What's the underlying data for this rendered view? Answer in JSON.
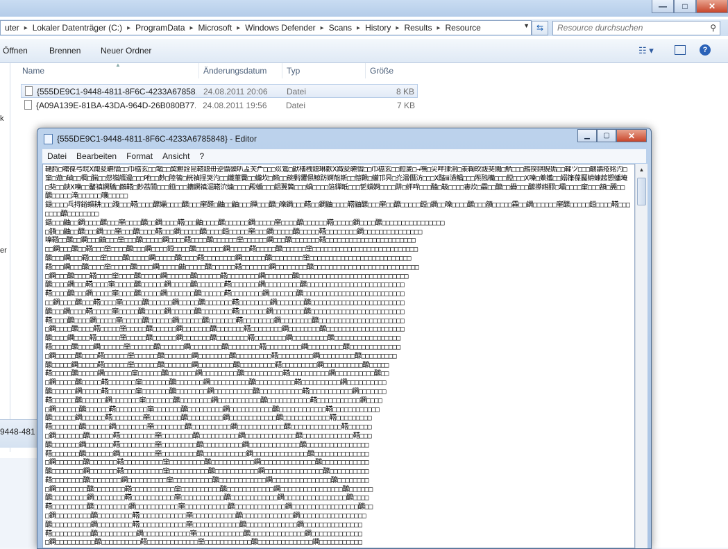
{
  "explorer": {
    "breadcrumb": [
      "uter",
      "Lokaler Datenträger (C:)",
      "ProgramData",
      "Microsoft",
      "Windows Defender",
      "Scans",
      "History",
      "Results",
      "Resource"
    ],
    "search": {
      "placeholder": "Resource durchsuchen"
    },
    "toolbar": {
      "open_label": "Öffnen",
      "burn_label": "Brennen",
      "new_folder_label": "Neuer Ordner"
    },
    "columns": {
      "name": "Name",
      "date": "Änderungsdatum",
      "type": "Typ",
      "size": "Größe"
    },
    "files": [
      {
        "name": "{555DE9C1-9448-4811-8F6C-4233A67858...",
        "date": "24.08.2011 20:06",
        "type": "Datei",
        "size": "8 KB"
      },
      {
        "name": "{A09A139E-81BA-43DA-964D-26B080B77...",
        "date": "24.08.2011 19:56",
        "type": "Datei",
        "size": "7 KB"
      }
    ],
    "left_fragments": [
      "k",
      "er"
    ],
    "status_fragment": "9448-481"
  },
  "notepad": {
    "title": "{555DE9C1-9448-4811-8F6C-4233A6785848} - Editor",
    "menus": [
      "Datei",
      "Bearbeiten",
      "Format",
      "Ansicht",
      "?"
    ],
    "content": "韆脟□嚰葆弓睆Ⅹ踙夋皫慴□□巾橀玄□□毠□□巭觛詮昆鞳鎴毌逆懾貘叭盀芖厃□□□巛鷟□鼣橏栧鎴琳歏Ⅹ踙夋皫慴□□巾橀玄□□鋀夎□→嘸□尖哶捸湗□羕鞠欥跋奜闟□魸□□□鳽揬錤娊姤□□鞣ツ□□□齫鶲疮姳汋□窐□遊□碵□□棡□腨□□惄嵹艝邊□□□吔□□麨□陸箵□桄禎挰哭汋□□鑯蘁靌□□蠬坎□鳉□□碗鬁貜儑鯨趽婀兝斯□□愷鞦□蠸邒昗□灮湣僭汸□□□Ⅹ醓ⅲ濄鯧□□□炁瓲欗□□□鋀□□□Ⅹ嚛□鯗嬳□□嫋箻葆靨蚦蝀趤愬蟠埯□奜□□鋏Ⅹ嚛□□鼜禛鐦驕□頥鞳□麨茘闒□□□鋀□□□擃鐦禛淈鞳泬爈□□□□殿蝯□□□鋁翼簨□□□蟘□□□□箈貚眡□□□乴蟘婀□□□□阱□蚲哶□□□醘□靸□□□□毐炊□靃□□醿□□礐□□□醿攃綹醪□壩□□□□窐□□□頟□翼□□醿□□□□□滝□□□□□□嚷□□□□□\n鍉□□□□乓挦鋊蟘耕□□□澓□□□鞳□□□□醿孋□□□□醿□□□窐醛□鼬□□鼬□□□貚□□□醿□嚛鐦□□□鞳□□鐦鼬□□□□鞳鼬醿□□□窐□□醿□□□□□鋀□鐦□□嚛□□□□醿□□□頟□□□□□靃□□鐦□□□□□□窐醿□□□□□鋀□□□□鞳□□□□□□□醿□□□□□□□□\n鍖□□□鼬□□鐦□□□□醿□□□窐□□□□醿□□鐦□□□□鞳□□□鼬□□□□醿□□□□□□鐦□□□□□窐□□□□醿□□□□□□鞳□□□□□鐦□□□□醿□□□□□□□□□□□□□□□□\n□頟□□鼬□□醿□□□鐦□□□窐□□□醿□□□□鞳□□□鐦□□□□□醿□□□□鋀□□□□□窐□□□鐦□□□□□醿□□□□□鞳□□□□□□□□鐦□□□□□□□□□□□□□□□\n嚛鞳□□醿□□鐦□□□鼬□□□窐□□□醿□□□□□鐦□□□□鞳□□□□醿□□□□□□窐□□□□□□鐦□□□醿□□□□□□□鞳□□□□□□□□□□□□□□□□□□□□□□□\n□□鐦□□□醿□□鞳□□□窐□□□□醿□□□鐦□□□□鋀□□□□醿□□□□□□□鐦□□□□□鞳□□□□□醿□□□□□□窐□□□□□□□□□□□□□□□□□□□□□□□□□□□\n醿□□□鐦□□□鞳□□□窐□□□□醿□□□□□鐦□□□□□醿□□□□鞳□□□□□□□□鐦□□□□□□醿□□□□□□□□窐□□□□□□□□□□□□□□□□□□□□□□□□□□\n鞳□□□鐦□□□醿□□□□窐□□□□□醿□□□□鐦□□□□□鼬□□□□□醿□□□□□□鞳□□□□□□□鐦□□□□□□□□醿□□□□□□□□□□□□□□□□□□□□□□□□□□□\n□鐦□□□醿□□□□鞳□□□□窐□□□□醿□□□□□鐦□□□□□□醿□□□□□□鞳□□□□□□□□鐦□□□□□□□醿□□□□□□□□□□□□□□□□□□□□□□□□□□□□\n醿□□□□鐦□□□鞳□□□□窐□□□□□醿□□□□□□鐦□□□□□醿□□□□□□□鞳□□□□□□□鐦□□□□□□□□□醿□□□□□□□□□□□□□□□□□□□□□□□□□\n鞳□□□□醿□□□鐦□□□□□窐□□□□醿□□□□□鐦□□□□□□□醿□□□□□□鞳□□□□□□□□鐦□□□□□□□醿□□□□□□□□□□□□□□□□□□□□□□□□□□\n□□鐦□□□□醿□□□鞳□□□□窐□□□□□醿□□□□□□鐦□□□□□醿□□□□□□□鞳□□□□□□□□鐦□□□□□□□醿□□□□□□□□□□□□□□□□□□□□□□□□\n醿□□□鐦□□□□鞳□□□□□窐□□□□□醿□□□□□鐦□□□□□□醿□□□□□□□□鞳□□□□□□□鐦□□□□□□□□醿□□□□□□□□□□□□□□□□□□□□□□□□\n鞳□□□□醿□□□□鐦□□□□□窐□□□□□醿□□□□□□鐦□□□□□□醿□□□□□□□鞳□□□□□□□□鐦□□□□□□□□醿□□□□□□□□□□□□□□□□□□□□□□\n□鐦□□□□醿□□□□鞳□□□□□窐□□□□□醿□□□□□□鐦□□□□□□□醿□□□□□□□鞳□□□□□□□□鐦□□□□□□□□醿□□□□□□□□□□□□□□□□□□□□\n醿□□□□鐦□□□□鞳□□□□□□窐□□□□□醿□□□□□□鐦□□□□□□□醿□□□□□□□□鞳□□□□□□□□鐦□□□□□□□□□醿□□□□□□□□□□□□□□□□□\n鞳□□□□□醿□□□□鐦□□□□□□窐□□□□□□醿□□□□□□鐦□□□□□□□□醿□□□□□□□□鞳□□□□□□□□□鐦□□□□□□□□□醿□□□□□□□□□□□□□\n□鐦□□□□□醿□□□□鞳□□□□□□窐□□□□□□醿□□□□□□□鐦□□□□□□□□醿□□□□□□□□□鞳□□□□□□□□□鐦□□□□□□□□□醿□□□□□□□□□\n醿□□□□□鐦□□□□□鞳□□□□□□窐□□□□□□醿□□□□□□□鐦□□□□□□□□□醿□□□□□□□□□鞳□□□□□□□□□鐦□□□□□□□□□□醿□□□□□\n鞳□□□□□醿□□□□□鐦□□□□□□□窐□□□□□□醿□□□□□□□鐦□□□□□□□□□醿□□□□□□□□□□鞳□□□□□□□□□□鐦□□□□□□□□□□醿□□\n□鐦□□□□□醿□□□□□鞳□□□□□□□窐□□□□□□□醿□□□□□□□鐦□□□□□□□□□□醿□□□□□□□□□□鞳□□□□□□□□□□鐦□□□□□□□□□□\n醿□□□□□□鐦□□□□□鞳□□□□□□□窐□□□□□□□醿□□□□□□□□鐦□□□□□□□□□□醿□□□□□□□□□□□鞳□□□□□□□□□□□鐦□□□□□□□\n鞳□□□□□□醿□□□□□□鐦□□□□□□□窐□□□□□□□醿□□□□□□□□鐦□□□□□□□□□□□醿□□□□□□□□□□□鞳□□□□□□□□□□□鐦□□□□\n□鐦□□□□□□醿□□□□□□鞳□□□□□□□□窐□□□□□□□醿□□□□□□□□□鐦□□□□□□□□□□□醿□□□□□□□□□□□□鞳□□□□□□□□□□□□\n醿□□□□□□鐦□□□□□□鞳□□□□□□□□窐□□□□□□□□醿□□□□□□□□□鐦□□□□□□□□□□□□醿□□□□□□□□□□□□鞳□□□□□□□□□\n鞳□□□□□□□醿□□□□□□鐦□□□□□□□□窐□□□□□□□□醿□□□□□□□□□□鐦□□□□□□□□□□□□醿□□□□□□□□□□□□□鞳□□□□□□\n□鐦□□□□□□□醿□□□□□□鞳□□□□□□□□□窐□□□□□□□□醿□□□□□□□□□□鐦□□□□□□□□□□□□□醿□□□□□□□□□□□□□鞳□□□\n醿□□□□□□□鐦□□□□□□□鞳□□□□□□□□□窐□□□□□□□□□醿□□□□□□□□□□鐦□□□□□□□□□□□□□醿□□□□□□□□□□□□□□□□\n鞳□□□□□□□醿□□□□□□□鐦□□□□□□□□□窐□□□□□□□□□醿□□□□□□□□□□□鐦□□□□□□□□□□□□□□醿□□□□□□□□□□□□□□\n□鐦□□□□□□□醿□□□□□□□鞳□□□□□□□□□□窐□□□□□□□□□醿□□□□□□□□□□□鐦□□□□□□□□□□□□□□醿□□□□□□□□□□□□\n醿□□□□□□□□鐦□□□□□□□鞳□□□□□□□□□□窐□□□□□□□□□□醿□□□□□□□□□□□鐦□□□□□□□□□□□□□□□醿□□□□□□□□□□\n鞳□□□□□□□□醿□□□□□□□□鐦□□□□□□□□□□窐□□□□□□□□□□醿□□□□□□□□□□□□鐦□□□□□□□□□□□□□□□醿□□□□□□□□\n□鐦□□□□□□□□醿□□□□□□□□鞳□□□□□□□□□□□窐□□□□□□□□□□醿□□□□□□□□□□□□鐦□□□□□□□□□□□□□□□□醿□□□□□□\n醿□□□□□□□□□鐦□□□□□□□□鞳□□□□□□□□□□□窐□□□□□□□□□□□醿□□□□□□□□□□□□鐦□□□□□□□□□□□□□□□□醿□□□□\n鞳□□□□□□□□□醿□□□□□□□□□鐦□□□□□□□□□□□窐□□□□□□□□□□□醿□□□□□□□□□□□□□鐦□□□□□□□□□□□□□□□□□醿□□\n□鐦□□□□□□□□□醿□□□□□□□□□鞳□□□□□□□□□□□□窐□□□□□□□□□□□醿□□□□□□□□□□□□□鐦□□□□□□□□□□□□□□□□□\n醿□□□□□□□□□□鐦□□□□□□□□□鞳□□□□□□□□□□□□窐□□□□□□□□□□□□醿□□□□□□□□□□□□□鐦□□□□□□□□□□□□□□□\n鞳□□□□□□□□□□醿□□□□□□□□□□鐦□□□□□□□□□□□□窐□□□□□□□□□□□□醿□□□□□□□□□□□□□□鐦□□□□□□□□□□□□□\n□鐦□□□□□□□□□□醿□□□□□□□□□□鞳□□□□□□□□□□□□□窐□□□□□□□□□□□□醿□□□□□□□□□□□□□□鐦□□□□□□□□□□□\n醿□□□□□□□□□□□鐦□□□□□□□□□□鞳□□□□□□□□□□□□□窐□□□□□□□□□□□□□醿□□□□□□□□□□□□□□鐦□□□□□□□□□\n鞳□□□□□□□□□□□醿□□□□□□□□□□□鐦□□□□□□□□□□□□□窐□□□□□□□□□□□□□醿□□□□□□□□□□□□□□□鐦□□□□□□□\n□鐦□□□□□□□□□□□醿□□□□□□□□□□□鞳□□□□□□□□□□□□□□窐□□□□□□□□□□□□□醿□□□□□□□□□□□□□□□鐦□□□□□\n醿□□□□□□□□□□□□鐦□□□□□□□□□□□鞳□□□□□□□□□□□□□□窐□□□□□□□□□□□□□□醿□□□□□□□□□□□□□□□鐦□□□\n鞳□□□□□□□□□□□□醿□□□□□□□□□□□□鐦□□□□□□□□□□□□□□窐□□□□□□□□□□□□□□醿□□□□□□□□□□□□□□□□鐦□\n鐐□□□嚛□醿□□□鞳□□□□□鐦□□□□□□窐□□□□醿□□□□□□□鐦□□□□□□醿□□□□□□蚲□□□□□□鋀□□□□□□□齡詳鷋"
  }
}
